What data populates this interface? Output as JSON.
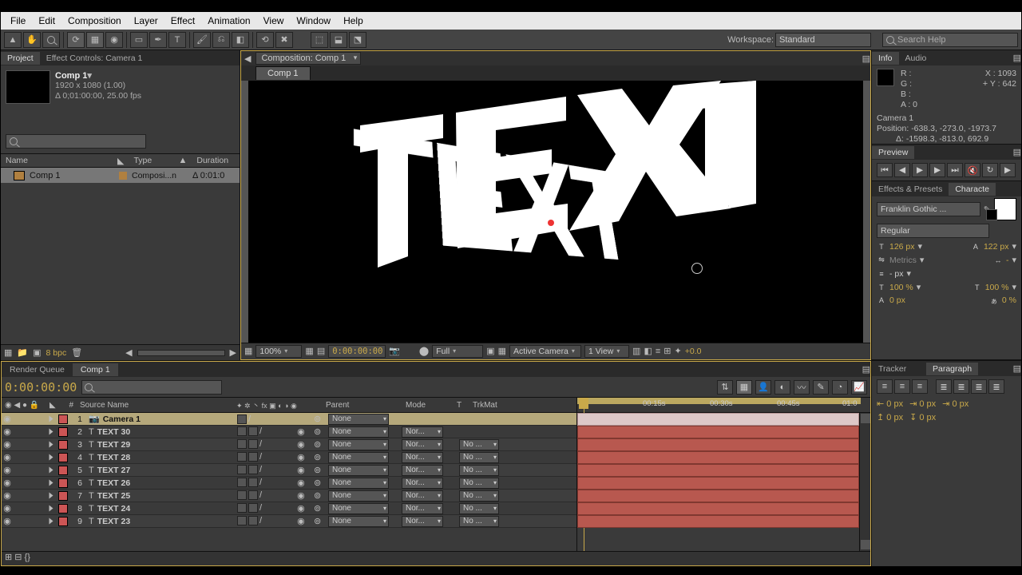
{
  "menu": [
    "File",
    "Edit",
    "Composition",
    "Layer",
    "Effect",
    "Animation",
    "View",
    "Window",
    "Help"
  ],
  "workspace": {
    "label": "Workspace:",
    "value": "Standard"
  },
  "search_help": "Search Help",
  "project": {
    "tabs": {
      "project": "Project",
      "fx": "Effect Controls: Camera 1"
    },
    "item_title": "Comp 1",
    "item_sub1": "1920 x 1080 (1.00)",
    "item_sub2": "Δ 0;01:00:00, 25.00 fps",
    "cols": {
      "name": "Name",
      "type": "Type",
      "dur": "Duration"
    },
    "row": {
      "name": "Comp 1",
      "type": "Composi...n",
      "dur": "Δ 0:01:0"
    },
    "bpc": "8 bpc"
  },
  "comp": {
    "crumb": "Composition: Comp 1",
    "tab": "Comp 1",
    "footer": {
      "zoom": "100%",
      "time": "0:00:00:00",
      "res": "Full",
      "view": "Active Camera",
      "nviews": "1 View",
      "exp": "+0.0"
    }
  },
  "info": {
    "tab_info": "Info",
    "tab_audio": "Audio",
    "R": "R :",
    "G": "G :",
    "B": "B :",
    "A": "A :  0",
    "X": "X : 1093",
    "Y": "Y :  642",
    "cam": "Camera 1",
    "pos": "Position: -638.3, -273.0, -1973.7",
    "delta": "Δ: -1598.3, -813.0, 692.9"
  },
  "preview": {
    "tab": "Preview"
  },
  "char": {
    "tab_fx": "Effects & Presets",
    "tab_char": "Characte",
    "font": "Franklin Gothic ...",
    "style": "Regular",
    "size": "126 px",
    "autolead": "122 px",
    "tracking": "Metrics",
    "kern": "-",
    "stroke": "- px",
    "leading": "",
    "vscale": "100 %",
    "hscale": "100 %",
    "baseline": "0 px",
    "tsume": "0 %"
  },
  "tl": {
    "tab_rq": "Render Queue",
    "tab_comp": "Comp 1",
    "timecode": "0:00:00:00",
    "cols": {
      "num": "#",
      "name": "Source Name",
      "mode": "Mode",
      "t": "T",
      "trk": "TrkMat",
      "parent": "Parent"
    },
    "ruler": [
      "00:15s",
      "00:30s",
      "00:45s",
      "01:0"
    ],
    "layers": [
      {
        "n": 1,
        "name": "Camera 1",
        "cam": true
      },
      {
        "n": 2,
        "name": "TEXT 30"
      },
      {
        "n": 3,
        "name": "TEXT 29"
      },
      {
        "n": 4,
        "name": "TEXT 28"
      },
      {
        "n": 5,
        "name": "TEXT 27"
      },
      {
        "n": 6,
        "name": "TEXT 26"
      },
      {
        "n": 7,
        "name": "TEXT 25"
      },
      {
        "n": 8,
        "name": "TEXT 24"
      },
      {
        "n": 9,
        "name": "TEXT 23"
      }
    ],
    "parent_none": "None",
    "mode_nor": "Nor...",
    "trk_no": "No ..."
  },
  "tracker": {
    "tab_t": "Tracker",
    "tab_p": "Paragraph",
    "px": "0 px"
  }
}
